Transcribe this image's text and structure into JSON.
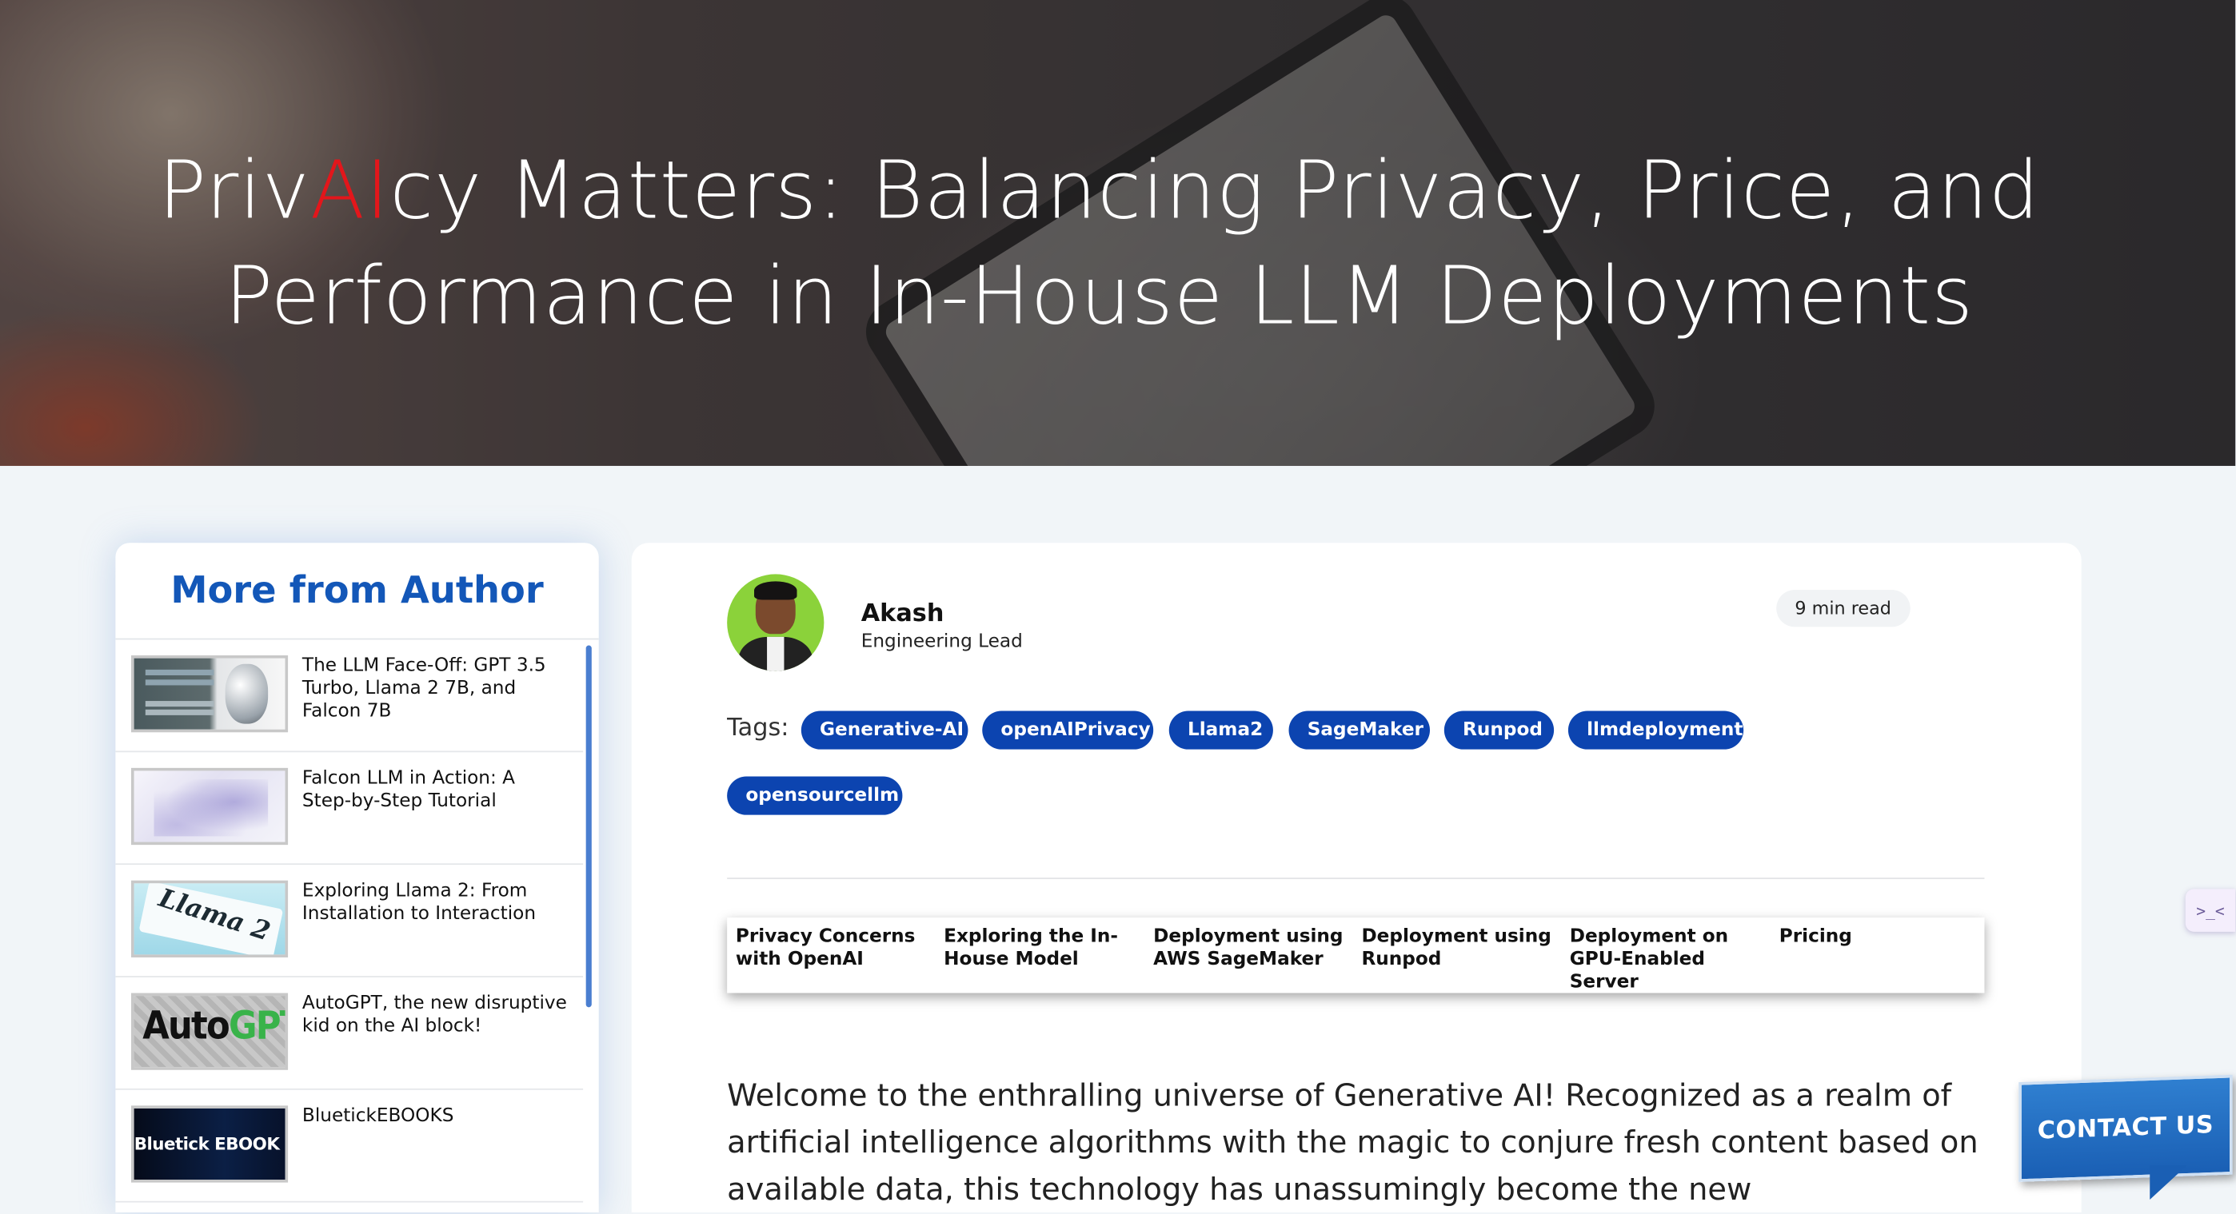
{
  "hero": {
    "title_part1": "Priv",
    "title_highlight": "AI",
    "title_part2": "cy Matters: Balancing Privacy, Price, and",
    "title_line2": "Performance in In-House LLM Deployments"
  },
  "sidebar": {
    "title": "More from Author",
    "items": [
      {
        "label": "The LLM Face-Off: GPT 3.5 Turbo, Llama 2 7B, and Falcon 7B",
        "thumb": "ultimate-tech-showdown-robot"
      },
      {
        "label": "Falcon LLM in Action: A Step-by-Step Tutorial",
        "thumb": "falcon-abstract"
      },
      {
        "label": "Exploring Llama 2: From Installation to Interaction",
        "thumb": "llama-2-paper",
        "thumb_text": "Llama 2"
      },
      {
        "label": "AutoGPT, the new disruptive kid on the AI block!",
        "thumb": "autogpt-logo",
        "thumb_text_a": "Auto",
        "thumb_text_b": "GPT"
      },
      {
        "label": "BluetickEBOOKS",
        "thumb": "bluetick-ebook",
        "thumb_text": "Bluetick EBOOK"
      }
    ]
  },
  "author": {
    "name": "Akash",
    "role": "Engineering Lead",
    "read_time": "9 min read"
  },
  "tags": {
    "label": "Tags:",
    "items": [
      "Generative-AI",
      "openAIPrivacy",
      "Llama2",
      "SageMaker",
      "Runpod",
      "llmdeployment",
      "opensourcellm"
    ]
  },
  "toc": {
    "items": [
      "Privacy Concerns with OpenAI",
      "Exploring the In-House Model",
      "Deployment using AWS SageMaker",
      "Deployment using Runpod",
      "Deployment on GPU-Enabled Server",
      "Pricing"
    ]
  },
  "article": {
    "intro": "Welcome to the enthralling universe of Generative AI! Recognized as a realm of artificial intelligence algorithms with the magic to conjure fresh content based on available data, this technology has unassumingly become the new"
  },
  "widget": {
    "glyph": ">_<"
  },
  "contact": {
    "label": "CONTACT US"
  },
  "colors": {
    "brand_blue": "#0c44b0",
    "title_blue": "#1357b8",
    "highlight_red": "#e3161b",
    "page_bg": "#f1f5f8"
  }
}
